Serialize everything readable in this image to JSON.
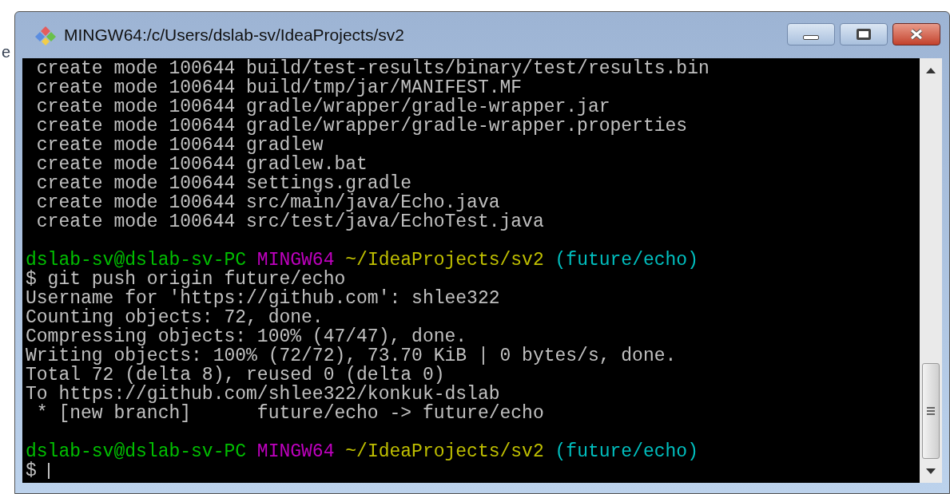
{
  "background": {
    "fragment": "e"
  },
  "window": {
    "title": "MINGW64:/c/Users/dslab-sv/IdeaProjects/sv2"
  },
  "terminal": {
    "lines": [
      {
        "kind": "text",
        "segments": [
          {
            "text": " create mode 100644 build/test-results/binary/test/results.bin",
            "color": "#c0c0c0"
          }
        ]
      },
      {
        "kind": "text",
        "segments": [
          {
            "text": " create mode 100644 build/tmp/jar/MANIFEST.MF",
            "color": "#c0c0c0"
          }
        ]
      },
      {
        "kind": "text",
        "segments": [
          {
            "text": " create mode 100644 gradle/wrapper/gradle-wrapper.jar",
            "color": "#c0c0c0"
          }
        ]
      },
      {
        "kind": "text",
        "segments": [
          {
            "text": " create mode 100644 gradle/wrapper/gradle-wrapper.properties",
            "color": "#c0c0c0"
          }
        ]
      },
      {
        "kind": "text",
        "segments": [
          {
            "text": " create mode 100644 gradlew",
            "color": "#c0c0c0"
          }
        ]
      },
      {
        "kind": "text",
        "segments": [
          {
            "text": " create mode 100644 gradlew.bat",
            "color": "#c0c0c0"
          }
        ]
      },
      {
        "kind": "text",
        "segments": [
          {
            "text": " create mode 100644 settings.gradle",
            "color": "#c0c0c0"
          }
        ]
      },
      {
        "kind": "text",
        "segments": [
          {
            "text": " create mode 100644 src/main/java/Echo.java",
            "color": "#c0c0c0"
          }
        ]
      },
      {
        "kind": "text",
        "segments": [
          {
            "text": " create mode 100644 src/test/java/EchoTest.java",
            "color": "#c0c0c0"
          }
        ]
      },
      {
        "kind": "blank"
      },
      {
        "kind": "text",
        "segments": [
          {
            "text": "dslab-sv@dslab-sv-PC ",
            "color": "#00bf00"
          },
          {
            "text": "MINGW64 ",
            "color": "#bf00bf"
          },
          {
            "text": "~/IdeaProjects/sv2 ",
            "color": "#bfbf00"
          },
          {
            "text": "(future/echo)",
            "color": "#00bfbf"
          }
        ]
      },
      {
        "kind": "text",
        "segments": [
          {
            "text": "$ git push origin future/echo",
            "color": "#c0c0c0"
          }
        ]
      },
      {
        "kind": "text",
        "segments": [
          {
            "text": "Username for 'https://github.com': shlee322",
            "color": "#c0c0c0"
          }
        ]
      },
      {
        "kind": "text",
        "segments": [
          {
            "text": "Counting objects: 72, done.",
            "color": "#c0c0c0"
          }
        ]
      },
      {
        "kind": "text",
        "segments": [
          {
            "text": "Compressing objects: 100% (47/47), done.",
            "color": "#c0c0c0"
          }
        ]
      },
      {
        "kind": "text",
        "segments": [
          {
            "text": "Writing objects: 100% (72/72), 73.70 KiB | 0 bytes/s, done.",
            "color": "#c0c0c0"
          }
        ]
      },
      {
        "kind": "text",
        "segments": [
          {
            "text": "Total 72 (delta 8), reused 0 (delta 0)",
            "color": "#c0c0c0"
          }
        ]
      },
      {
        "kind": "text",
        "segments": [
          {
            "text": "To https://github.com/shlee322/konkuk-dslab",
            "color": "#c0c0c0"
          }
        ]
      },
      {
        "kind": "text",
        "segments": [
          {
            "text": " * [new branch]      future/echo -> future/echo",
            "color": "#c0c0c0"
          }
        ]
      },
      {
        "kind": "blank"
      },
      {
        "kind": "text",
        "segments": [
          {
            "text": "dslab-sv@dslab-sv-PC ",
            "color": "#00bf00"
          },
          {
            "text": "MINGW64 ",
            "color": "#bf00bf"
          },
          {
            "text": "~/IdeaProjects/sv2 ",
            "color": "#bfbf00"
          },
          {
            "text": "(future/echo)",
            "color": "#00bfbf"
          }
        ]
      }
    ],
    "prompt": {
      "text": "$ ",
      "color": "#c0c0c0"
    }
  }
}
